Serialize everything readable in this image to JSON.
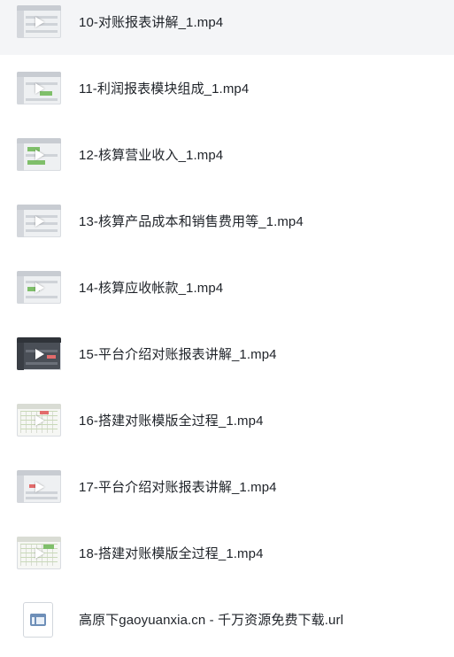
{
  "files": [
    {
      "name": "10-对账报表讲解_1.mp4",
      "type": "video",
      "selected": true
    },
    {
      "name": "11-利润报表模块组成_1.mp4",
      "type": "video"
    },
    {
      "name": "12-核算营业收入_1.mp4",
      "type": "video"
    },
    {
      "name": "13-核算产品成本和销售费用等_1.mp4",
      "type": "video"
    },
    {
      "name": "14-核算应收帐款_1.mp4",
      "type": "video"
    },
    {
      "name": "15-平台介绍对账报表讲解_1.mp4",
      "type": "video"
    },
    {
      "name": "16-搭建对账模版全过程_1.mp4",
      "type": "video"
    },
    {
      "name": "17-平台介绍对账报表讲解_1.mp4",
      "type": "video"
    },
    {
      "name": "18-搭建对账模版全过程_1.mp4",
      "type": "video"
    },
    {
      "name": "高原下gaoyuanxia.cn - 千万资源免费下载.url",
      "type": "url"
    }
  ],
  "icons": {
    "video_thumbnail": "video-thumbnail-icon",
    "play": "play-icon",
    "url_file": "url-file-icon"
  },
  "colors": {
    "selected_row_bg": "#f4f5f7",
    "text": "#1f2329"
  }
}
